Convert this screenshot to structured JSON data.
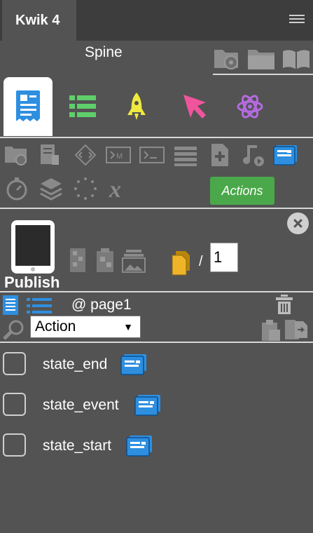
{
  "tab": {
    "title": "Kwik 4"
  },
  "header": {
    "title": "Spine"
  },
  "tool_buttons": {
    "actions_label": "Actions"
  },
  "publish": {
    "label": "Publish",
    "page_count_separator": "/",
    "page_total": "1"
  },
  "page": {
    "label": "@ page1"
  },
  "filter": {
    "selected": "Action",
    "caret": "▼"
  },
  "items": [
    {
      "label": "state_end"
    },
    {
      "label": "state_event"
    },
    {
      "label": "state_start"
    }
  ],
  "colors": {
    "panel_bg": "#535353",
    "tab_bar_bg": "#3d3d3d",
    "actions_green": "#4aa84a",
    "accent_blue": "#2196f3"
  }
}
